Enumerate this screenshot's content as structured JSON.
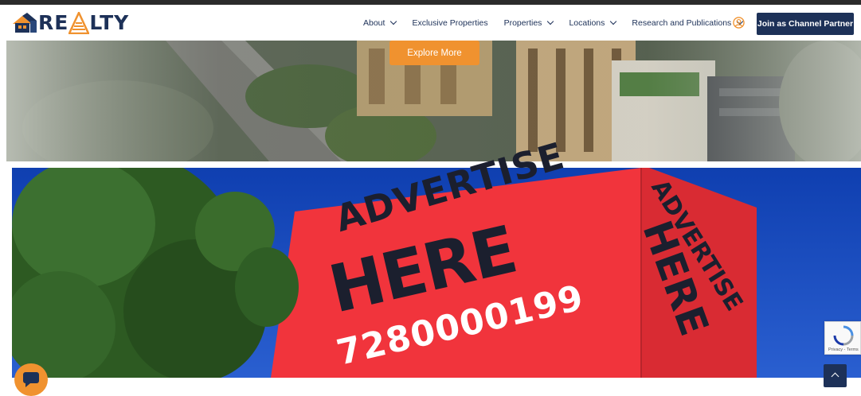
{
  "header": {
    "logo_text_left": "RE",
    "logo_text_right": "LTY",
    "menu": [
      {
        "label": "About",
        "has_dropdown": true
      },
      {
        "label": "Exclusive Properties",
        "has_dropdown": false
      },
      {
        "label": "Properties",
        "has_dropdown": true
      },
      {
        "label": "Locations",
        "has_dropdown": true
      },
      {
        "label": "Research and Publications",
        "has_dropdown": true
      }
    ],
    "user_icon": "user-circle-icon",
    "cta_label": "Join as Channel Partner"
  },
  "hero": {
    "button_label": "Explore More"
  },
  "ad_banner": {
    "line1": "ADVERTISE",
    "line2": "HERE",
    "phone": "7280000199",
    "side_line1": "ADVERTISE",
    "side_line2": "HERE"
  },
  "widgets": {
    "recaptcha_text": "Privacy - Terms",
    "chat_icon": "chat-bubble-icon",
    "scroll_top_icon": "chevron-up-icon"
  },
  "colors": {
    "brand_navy": "#1d3158",
    "brand_orange": "#f0922f",
    "ad_red": "#f1343c",
    "sky_blue": "#1a48b8"
  }
}
